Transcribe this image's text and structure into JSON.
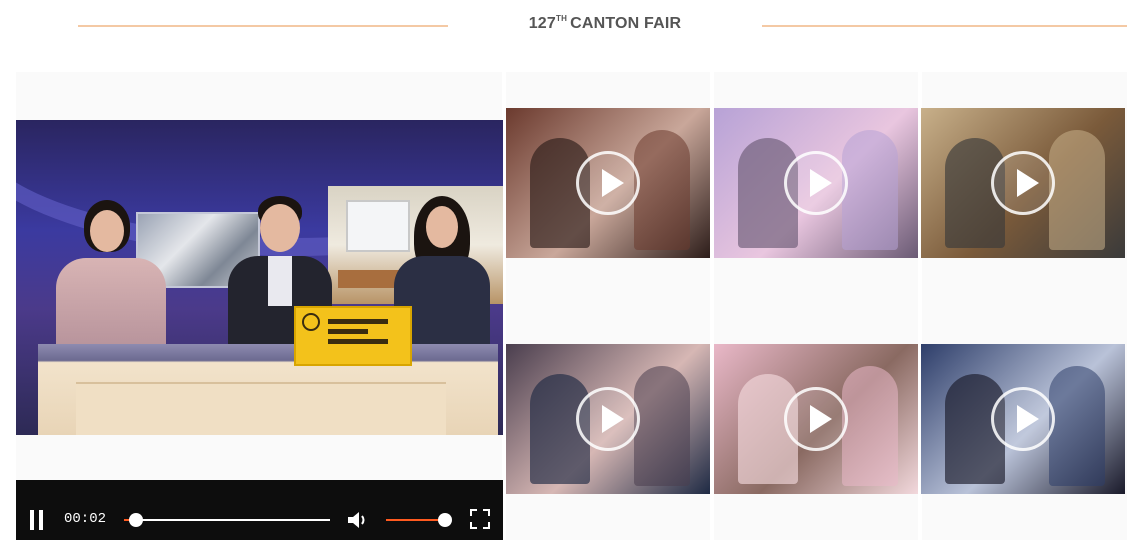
{
  "header": {
    "title_number": "127",
    "title_suffix": "TH",
    "title_rest": "CANTON FAIR",
    "rule_color": "#f4c9a4"
  },
  "main_video": {
    "time": "00:02",
    "progress_fraction": 0.06,
    "volume_fraction": 0.95,
    "accent_color": "#ff5a1f",
    "icons": {
      "play_pause": "pause-icon",
      "volume": "volume-icon",
      "fullscreen": "fullscreen-icon"
    }
  },
  "thumbnails": [
    {
      "icon": "play-icon",
      "tone": [
        "#6b3a2e",
        "#c9a79a",
        "#2c1d1a"
      ]
    },
    {
      "icon": "play-icon",
      "tone": [
        "#b7a2d6",
        "#e9c6df",
        "#6a5a74"
      ]
    },
    {
      "icon": "play-icon",
      "tone": [
        "#c8b08a",
        "#7a5a3a",
        "#3a3a3a"
      ]
    },
    {
      "icon": "play-icon",
      "tone": [
        "#4a3e4e",
        "#d6b7b4",
        "#1e2a44"
      ]
    },
    {
      "icon": "play-icon",
      "tone": [
        "#e9b8c8",
        "#8a6a62",
        "#f2d8dc"
      ]
    },
    {
      "icon": "play-icon",
      "tone": [
        "#2e3e6a",
        "#b9c2d8",
        "#1a1a2a"
      ]
    }
  ]
}
